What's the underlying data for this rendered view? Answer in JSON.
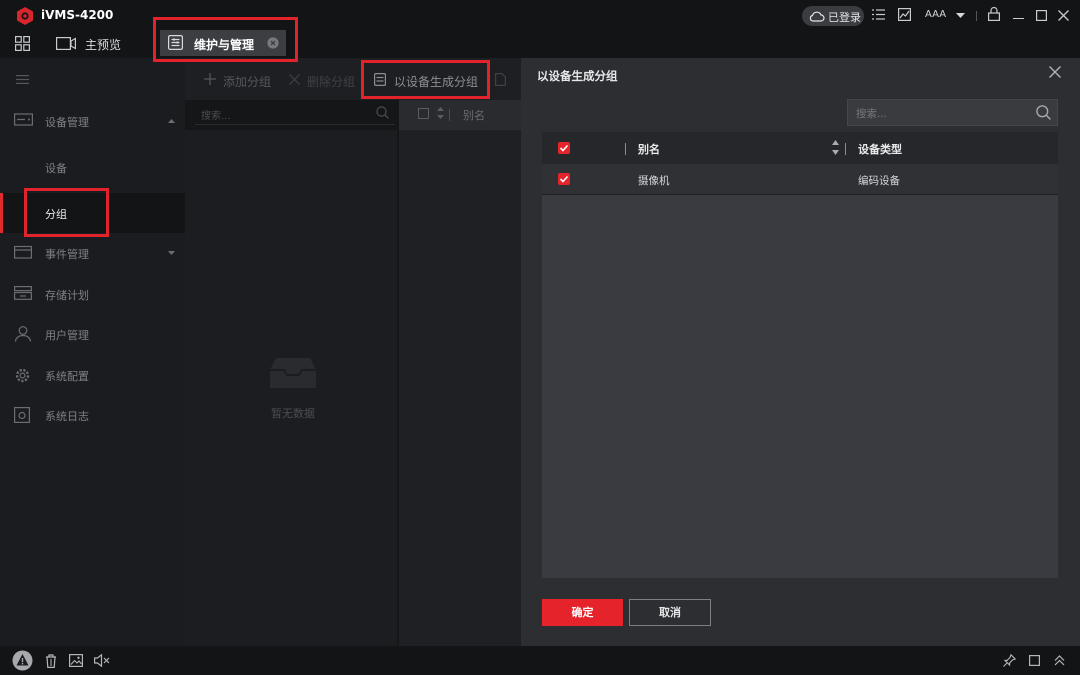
{
  "app": {
    "title": "iVMS-4200"
  },
  "titlebar": {
    "login_status": "已登录",
    "user": "AAA"
  },
  "tabs": [
    {
      "label": "主预览"
    },
    {
      "label": "维护与管理"
    }
  ],
  "sidebar": {
    "items": [
      {
        "label": "设备管理"
      },
      {
        "label": "设备"
      },
      {
        "label": "分组"
      },
      {
        "label": "事件管理"
      },
      {
        "label": "存储计划"
      },
      {
        "label": "用户管理"
      },
      {
        "label": "系统配置"
      },
      {
        "label": "系统日志"
      }
    ]
  },
  "toolbar": {
    "add_group": "添加分组",
    "delete_group": "删除分组",
    "create_from_device": "以设备生成分组"
  },
  "group_panel": {
    "search_placeholder": "搜索...",
    "empty_text": "暂无数据"
  },
  "mid_table": {
    "alias_header": "别名"
  },
  "modal": {
    "title": "以设备生成分组",
    "search_placeholder": "搜索...",
    "columns": [
      "别名",
      "设备类型"
    ],
    "rows": [
      {
        "alias": "摄像机",
        "type": "编码设备",
        "checked": true
      }
    ],
    "ok_label": "确定",
    "cancel_label": "取消"
  },
  "colors": {
    "accent": "#e5232a",
    "annotation": "#e3232b"
  }
}
